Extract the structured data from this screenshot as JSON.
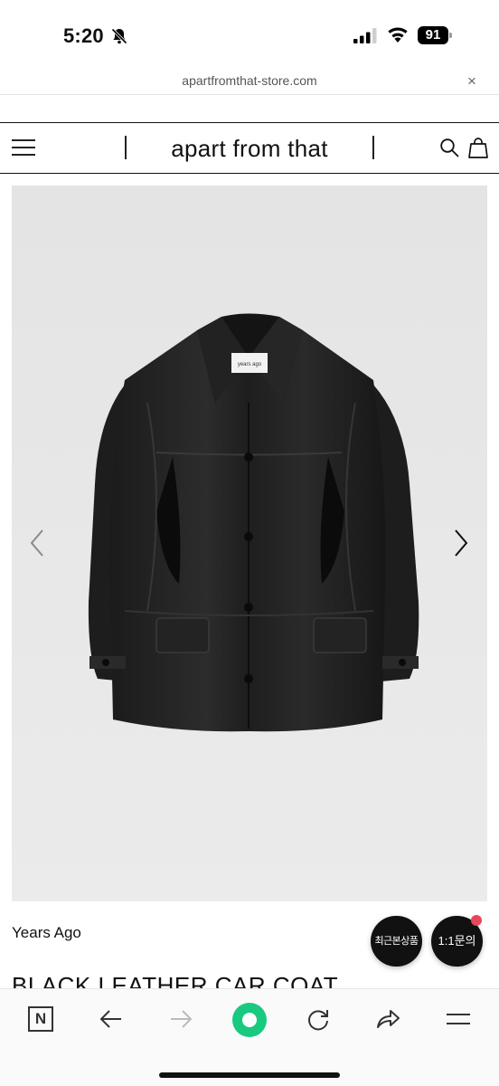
{
  "status_bar": {
    "time": "5:20",
    "battery": "91"
  },
  "browser": {
    "url": "apartfromthat-store.com",
    "close_label": "×"
  },
  "header": {
    "brand": "apart from that"
  },
  "product": {
    "image_label_text": "years ago",
    "brand": "Years Ago",
    "title": "BLACK LEATHER CAR COAT"
  },
  "floating": {
    "recent_label": "최근본상품",
    "inquiry_label": "1:1문의"
  },
  "colors": {
    "accent_green": "#19c97f",
    "notification_red": "#e8475a"
  },
  "icons": [
    "bell-slash-icon",
    "signal-icon",
    "wifi-icon",
    "battery-icon",
    "close-icon",
    "hamburger-menu-icon",
    "search-icon",
    "shopping-bag-icon",
    "chevron-left-icon",
    "chevron-right-icon",
    "naver-n-icon",
    "back-arrow-icon",
    "forward-arrow-icon",
    "home-icon",
    "reload-icon",
    "share-icon",
    "menu-icon"
  ]
}
